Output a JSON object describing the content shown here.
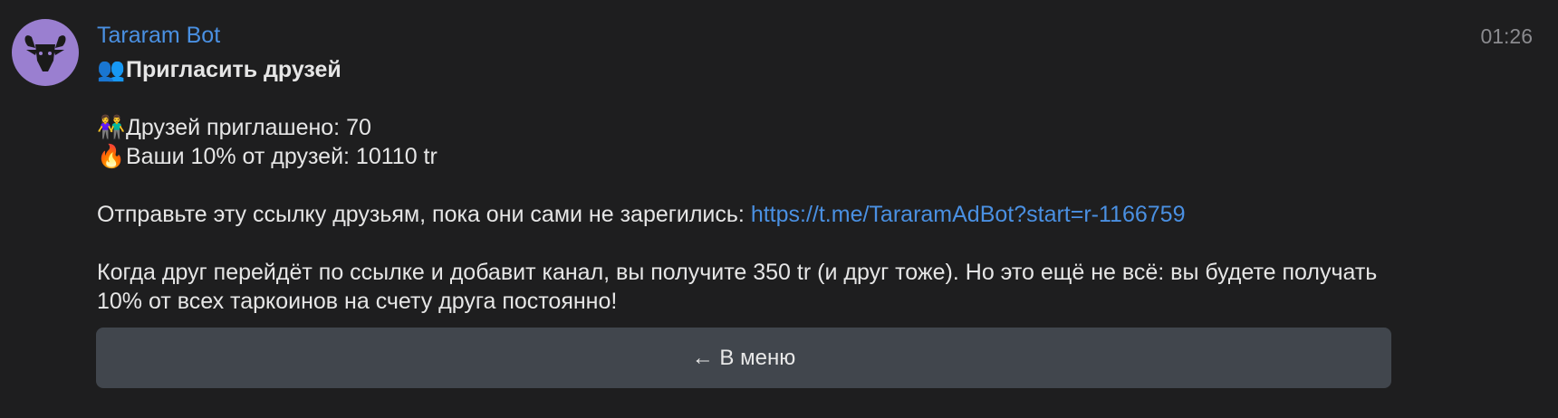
{
  "message": {
    "sender": "Tararam Bot",
    "time": "01:26",
    "title_emoji": "👥",
    "title": "Пригласить друзей",
    "stats": [
      {
        "emoji": "👫",
        "text": "Друзей приглашено: 70"
      },
      {
        "emoji": "🔥",
        "text": "Ваши 10% от друзей: 10110 tr"
      }
    ],
    "link_prefix": "Отправьте эту ссылку друзьям, пока они сами не зарегились: ",
    "link": "https://t.me/TararamAdBot?start=r-1166759",
    "paragraph": "Когда друг перейдёт по ссылке и добавит канал, вы получите 350 tr (и друг тоже). Но это ещё не всё: вы будете получать 10% от всех таркоинов на счету друга постоянно!"
  },
  "buttons": {
    "menu": "← В меню"
  },
  "colors": {
    "background": "#1e1e1f",
    "sender": "#4a90e2",
    "link": "#4a90e2",
    "avatar": "#9a7fd0",
    "button": "#41464d"
  },
  "icons": {
    "avatar": "goat-head-icon"
  }
}
